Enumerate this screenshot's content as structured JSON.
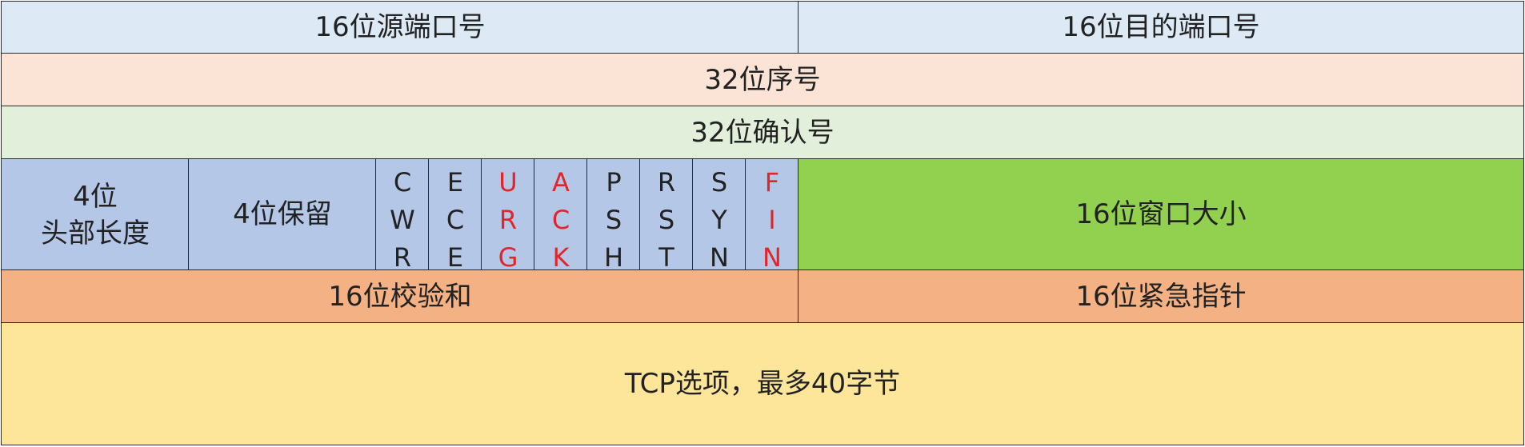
{
  "fields": {
    "src_port": "16位源端口号",
    "dst_port": "16位目的端口号",
    "seq": "32位序号",
    "ack_num": "32位确认号",
    "hdr_len_line1": "4位",
    "hdr_len_line2": "头部长度",
    "reserved": "4位保留",
    "window": "16位窗口大小",
    "checksum": "16位校验和",
    "urgent": "16位紧急指针",
    "options": "TCP选项，最多40字节"
  },
  "flags": [
    {
      "letters": [
        "C",
        "W",
        "R"
      ],
      "color": "#222222"
    },
    {
      "letters": [
        "E",
        "C",
        "E"
      ],
      "color": "#222222"
    },
    {
      "letters": [
        "U",
        "R",
        "G"
      ],
      "color": "#e0262b"
    },
    {
      "letters": [
        "A",
        "C",
        "K"
      ],
      "color": "#e0262b"
    },
    {
      "letters": [
        "P",
        "S",
        "H"
      ],
      "color": "#222222"
    },
    {
      "letters": [
        "R",
        "S",
        "T"
      ],
      "color": "#222222"
    },
    {
      "letters": [
        "S",
        "Y",
        "N"
      ],
      "color": "#222222"
    },
    {
      "letters": [
        "F",
        "I",
        "N"
      ],
      "color": "#e0262b"
    }
  ],
  "colors": {
    "port_row": "#ddeaf5",
    "seq_row": "#fbe3d6",
    "ack_row": "#e2efda",
    "header_row": "#b4c7e7",
    "window": "#92d050",
    "checksum_row": "#f4b183",
    "options_row": "#fde59a",
    "flag_highlight": "#e0262b"
  }
}
